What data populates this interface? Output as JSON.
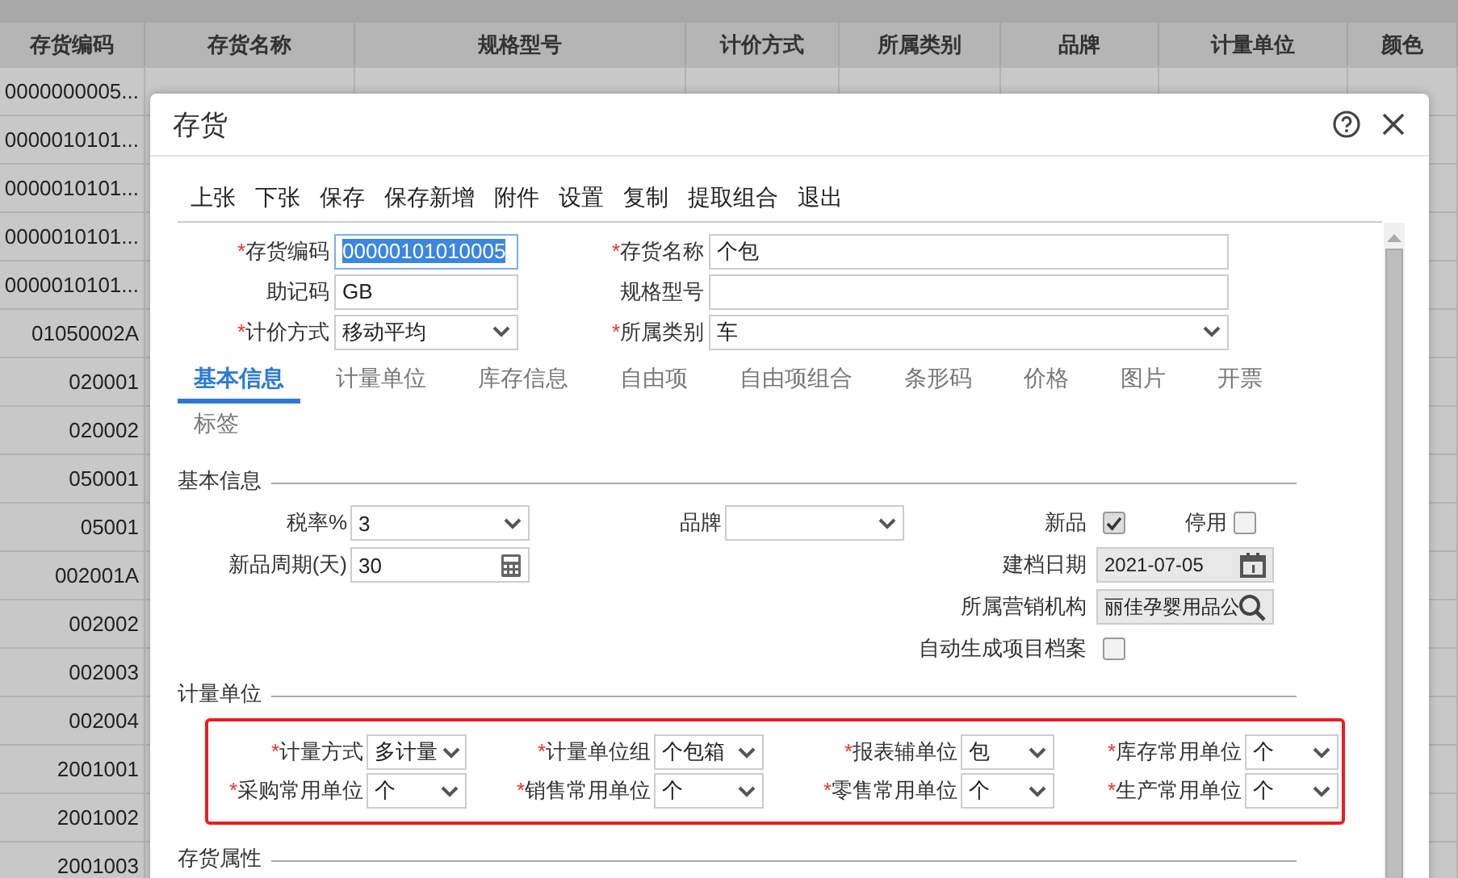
{
  "background_table": {
    "columns": [
      "存货编码",
      "存货名称",
      "规格型号",
      "计价方式",
      "所属类别",
      "品牌",
      "计量单位",
      "颜色"
    ],
    "rows": [
      [
        "0000000005..."
      ],
      [
        "0000010101..."
      ],
      [
        "0000010101..."
      ],
      [
        "0000010101..."
      ],
      [
        "0000010101..."
      ],
      [
        "01050002A"
      ],
      [
        "020001"
      ],
      [
        "020002"
      ],
      [
        "050001"
      ],
      [
        "05001"
      ],
      [
        "002001A"
      ],
      [
        "002002"
      ],
      [
        "002003"
      ],
      [
        "002004"
      ],
      [
        "2001001"
      ],
      [
        "2001002"
      ],
      [
        "2001003"
      ]
    ]
  },
  "dialog": {
    "title": "存货",
    "toolbar": [
      "上张",
      "下张",
      "保存",
      "保存新增",
      "附件",
      "设置",
      "复制",
      "提取组合",
      "退出"
    ],
    "header_fields": [
      {
        "left": {
          "marker": "*",
          "label": "存货编码",
          "kind": "text",
          "value": "00000101010005",
          "focused": true
        },
        "right": {
          "marker": "*",
          "label": "存货名称",
          "kind": "text",
          "value": "个包",
          "focused": false
        }
      },
      {
        "left": {
          "label": "助记码",
          "kind": "text",
          "value": "GB",
          "focused": false
        },
        "right": {
          "label": "规格型号",
          "kind": "text",
          "focused": false
        }
      },
      {
        "left": {
          "marker": "*",
          "label": "计价方式",
          "kind": "select",
          "value": "移动平均",
          "focused": false
        },
        "right": {
          "marker": "*",
          "label": "所属类别",
          "kind": "select",
          "value": "车",
          "focused": false
        }
      }
    ],
    "tabs": [
      {
        "label": "基本信息",
        "selected": true
      },
      {
        "label": "计量单位",
        "selected": false
      },
      {
        "label": "库存信息",
        "selected": false
      },
      {
        "label": "自由项",
        "selected": false
      },
      {
        "label": "自由项组合",
        "selected": false
      },
      {
        "label": "条形码",
        "selected": false
      },
      {
        "label": "价格",
        "selected": false
      },
      {
        "label": "图片",
        "selected": false
      },
      {
        "label": "开票",
        "selected": false
      },
      {
        "label": "标签",
        "selected": false
      }
    ],
    "basic_info": {
      "title": "基本信息",
      "rows": [
        {
          "left": {
            "label": "税率%",
            "kind": "select",
            "value": "3"
          },
          "middle": {
            "label": "品牌",
            "kind": "select"
          },
          "right": {
            "label": "新品",
            "kind": "checkbox",
            "checked": true,
            "extra": {
              "label": "停用",
              "checked": false
            }
          }
        },
        {
          "left": {
            "label": "新品周期(天)",
            "kind": "number",
            "value": "30"
          },
          "right": {
            "label": "建档日期",
            "kind": "date",
            "value": "2021-07-05"
          }
        },
        {
          "right": {
            "label": "所属营销机构",
            "kind": "lookup",
            "value": "丽佳孕婴用品公"
          }
        },
        {
          "right": {
            "label": "自动生成项目档案",
            "kind": "checkbox",
            "checked": false
          }
        }
      ]
    },
    "units": {
      "title": "计量单位",
      "highlighted": true,
      "fields": [
        {
          "marker": "*",
          "label": "计量方式",
          "value": "多计量"
        },
        {
          "marker": "*",
          "label": "计量单位组",
          "value": "个包箱"
        },
        {
          "marker": "*",
          "label": "报表辅单位",
          "value": "包"
        },
        {
          "marker": "*",
          "label": "库存常用单位",
          "value": "个"
        },
        {
          "marker": "*",
          "label": "采购常用单位",
          "value": "个"
        },
        {
          "marker": "*",
          "label": "销售常用单位",
          "value": "个"
        },
        {
          "marker": "*",
          "label": "零售常用单位",
          "value": "个"
        },
        {
          "marker": "*",
          "label": "生产常用单位",
          "value": "个"
        }
      ]
    },
    "properties": {
      "title": "存货属性"
    }
  }
}
